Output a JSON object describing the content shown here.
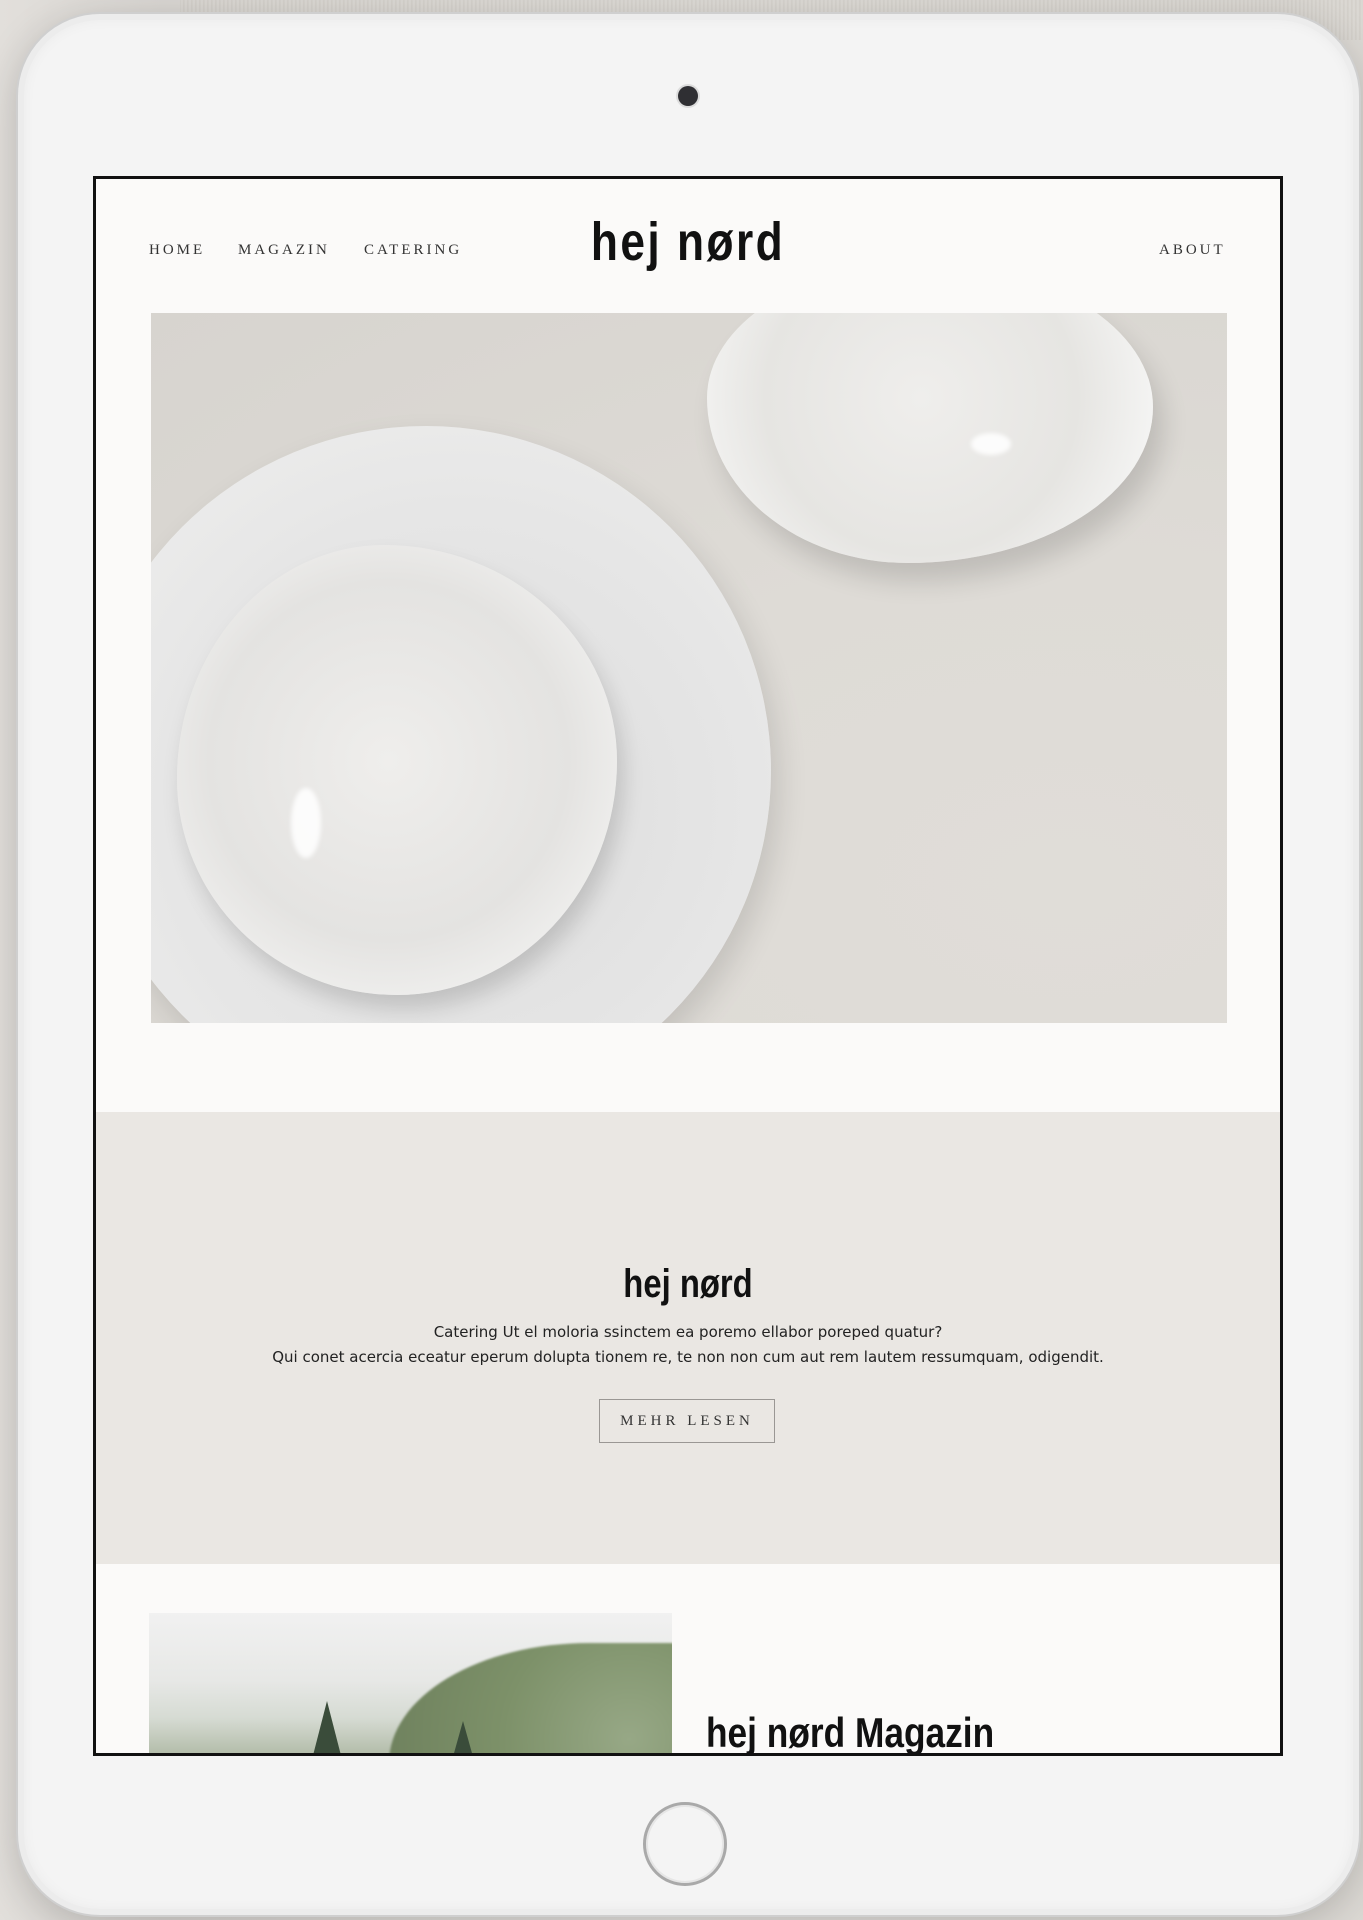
{
  "nav": {
    "left_links": [
      "HOME",
      "MAGAZIN",
      "CATERING"
    ],
    "right_link": "ABOUT",
    "logo": "hej nørd"
  },
  "intro": {
    "title": "hej nørd",
    "line1": "Catering Ut el moloria ssinctem ea poremo ellabor poreped quatur?",
    "line2": "Qui conet acercia eceatur eperum dolupta tionem re, te non non cum aut rem lautem ressumquam, odigendit.",
    "button": "MEHR LESEN"
  },
  "magazin": {
    "title": "hej nørd Magazin"
  },
  "colors": {
    "band": "#eae7e3",
    "page_bg": "#fbfaf9",
    "text": "#111111"
  }
}
